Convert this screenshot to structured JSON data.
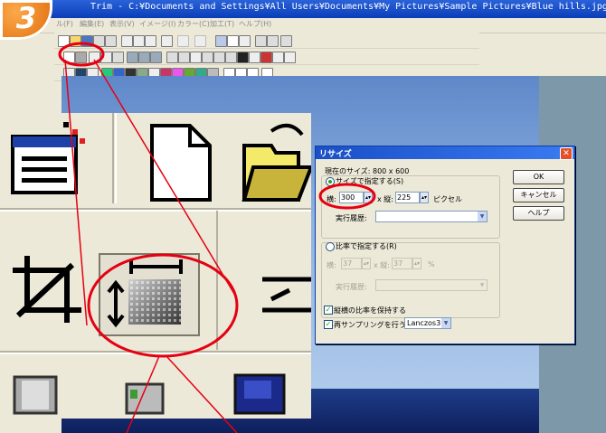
{
  "window": {
    "title": "Trim - C:¥Documents and Settings¥All Users¥Documents¥My Pictures¥Sample Pictures¥Blue hills.jpg"
  },
  "menu": [
    "ル(F)",
    "編集(E)",
    "表示(V)",
    "イメージ(I)",
    "カラー(C)",
    "加工(T)",
    "ヘルプ(H)"
  ],
  "step_badge": "3",
  "dialog": {
    "title": "リサイズ",
    "current_size_label": "現在のサイズ: 800 x 600",
    "size_option_label": "サイズで指定する(S)",
    "width_label": "横:",
    "width_value": "300",
    "height_label": "x 縦:",
    "height_value": "225",
    "pixel_unit": "ピクセル",
    "history_label": "実行履歴:",
    "ratio_option_label": "比率で指定する(R)",
    "ratio_width_label": "横:",
    "ratio_width_value": "37",
    "ratio_height_label": "x 縦:",
    "ratio_height_value": "37",
    "percent_unit": "%",
    "ratio_history_label": "実行履歴:",
    "keep_aspect_label": "縦横の比率を保持する",
    "resample_label": "再サンプリングを行う",
    "resample_method": "Lanczos3",
    "ok_label": "OK",
    "cancel_label": "キャンセル",
    "help_label": "ヘルプ"
  },
  "colors": {
    "annotation": "#e60012",
    "badge": "#f07d12",
    "titlebar": "#0a3eb8"
  },
  "icons": [
    "trim-icon",
    "resize-icon",
    "new-file-icon",
    "open-folder-icon",
    "menu-window-icon",
    "selection-icon"
  ]
}
